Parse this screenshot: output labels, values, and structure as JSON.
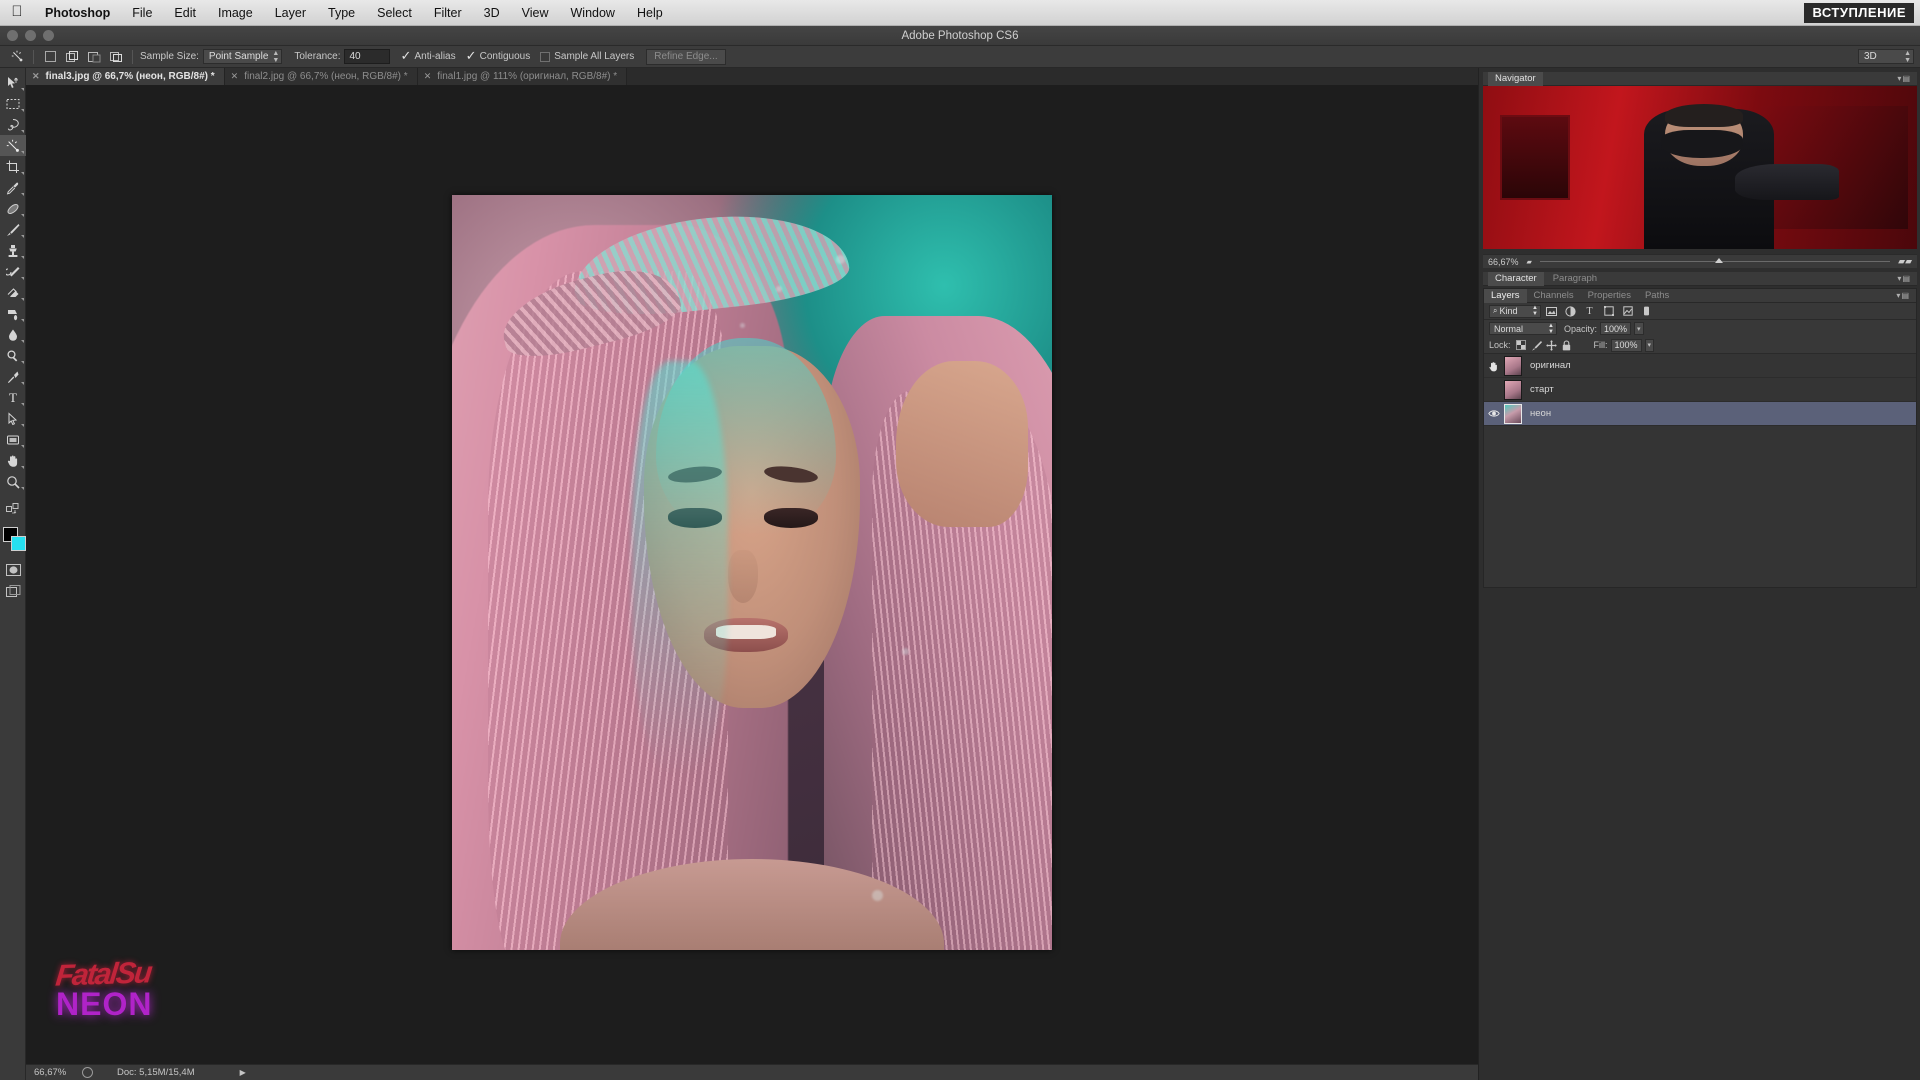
{
  "app": {
    "title": "Adobe Photoshop CS6",
    "badge": "ВСТУПЛЕНИЕ"
  },
  "menubar": {
    "apple": "apple-logo",
    "items": [
      {
        "label": "Photoshop",
        "bold": true
      },
      {
        "label": "File"
      },
      {
        "label": "Edit"
      },
      {
        "label": "Image"
      },
      {
        "label": "Layer"
      },
      {
        "label": "Type"
      },
      {
        "label": "Select"
      },
      {
        "label": "Filter"
      },
      {
        "label": "3D"
      },
      {
        "label": "View"
      },
      {
        "label": "Window"
      },
      {
        "label": "Help"
      }
    ]
  },
  "options_bar": {
    "tool_icon": "magic-wand-icon",
    "selection_modes": [
      "new-selection",
      "add-to-selection",
      "subtract-from-selection",
      "intersect-selection"
    ],
    "sample_size_label": "Sample Size:",
    "sample_size_value": "Point Sample",
    "tolerance_label": "Tolerance:",
    "tolerance_value": "40",
    "anti_alias_label": "Anti-alias",
    "anti_alias_checked": true,
    "contiguous_label": "Contiguous",
    "contiguous_checked": true,
    "sample_all_layers_label": "Sample All Layers",
    "sample_all_layers_checked": false,
    "refine_edge_label": "Refine Edge...",
    "workspace_value": "3D"
  },
  "tabs": [
    {
      "label": "final3.jpg @ 66,7% (неон, RGB/8#) *",
      "active": true
    },
    {
      "label": "final2.jpg @ 66,7% (неон, RGB/8#) *",
      "active": false
    },
    {
      "label": "final1.jpg @ 111% (оригинал, RGB/8#) *",
      "active": false
    }
  ],
  "toolbar": [
    {
      "name": "move-tool",
      "active": false
    },
    {
      "name": "rectangular-marquee-tool",
      "active": false
    },
    {
      "name": "lasso-tool",
      "active": false
    },
    {
      "name": "magic-wand-tool",
      "active": true
    },
    {
      "name": "crop-tool",
      "active": false
    },
    {
      "name": "eyedropper-tool",
      "active": false
    },
    {
      "name": "spot-healing-brush-tool",
      "active": false
    },
    {
      "name": "brush-tool",
      "active": false
    },
    {
      "name": "clone-stamp-tool",
      "active": false
    },
    {
      "name": "history-brush-tool",
      "active": false
    },
    {
      "name": "eraser-tool",
      "active": false
    },
    {
      "name": "gradient-tool",
      "active": false
    },
    {
      "name": "blur-tool",
      "active": false
    },
    {
      "name": "dodge-tool",
      "active": false
    },
    {
      "name": "pen-tool",
      "active": false
    },
    {
      "name": "horizontal-type-tool",
      "active": false
    },
    {
      "name": "path-selection-tool",
      "active": false
    },
    {
      "name": "rectangle-shape-tool",
      "active": false
    },
    {
      "name": "hand-tool",
      "active": false
    },
    {
      "name": "zoom-tool",
      "active": false
    }
  ],
  "colors": {
    "foreground": "#000000",
    "background": "#25e0f0",
    "selected_layer_highlight": "#5b6179",
    "accent_red": "#c2161d"
  },
  "navigator": {
    "title": "Navigator",
    "zoom": "66,67%"
  },
  "character_panel": {
    "tabs": [
      {
        "label": "Character",
        "active": true
      },
      {
        "label": "Paragraph",
        "active": false
      }
    ]
  },
  "layers_panel": {
    "tabs": [
      {
        "label": "Layers",
        "active": true
      },
      {
        "label": "Channels",
        "active": false
      },
      {
        "label": "Properties",
        "active": false
      },
      {
        "label": "Paths",
        "active": false
      }
    ],
    "filter_kind": "Kind",
    "filter_icons": [
      "pixel-filter-icon",
      "adjustment-filter-icon",
      "type-filter-icon",
      "shape-filter-icon",
      "smart-object-filter-icon",
      "filter-toggle-icon"
    ],
    "blend_mode": "Normal",
    "opacity_label": "Opacity:",
    "opacity_value": "100%",
    "lock_label": "Lock:",
    "lock_icons": [
      "lock-transparent-pixels-icon",
      "lock-image-pixels-icon",
      "lock-position-icon",
      "lock-all-icon"
    ],
    "fill_label": "Fill:",
    "fill_value": "100%",
    "layers": [
      {
        "name": "оригинал",
        "visible": false,
        "selected": false,
        "thumb": "portrait-pink"
      },
      {
        "name": "старт",
        "visible": false,
        "selected": false,
        "thumb": "portrait-pink"
      },
      {
        "name": "неон",
        "visible": true,
        "selected": true,
        "thumb": "portrait-neon"
      }
    ]
  },
  "status_bar": {
    "zoom": "66,67%",
    "doc_label": "Doc:",
    "doc_value": "5,15M/15,4M",
    "doc_full": "Doc: 5,15M/15,4M"
  },
  "watermark": {
    "top_text": "FatalSu",
    "bottom_text": "NEON"
  }
}
